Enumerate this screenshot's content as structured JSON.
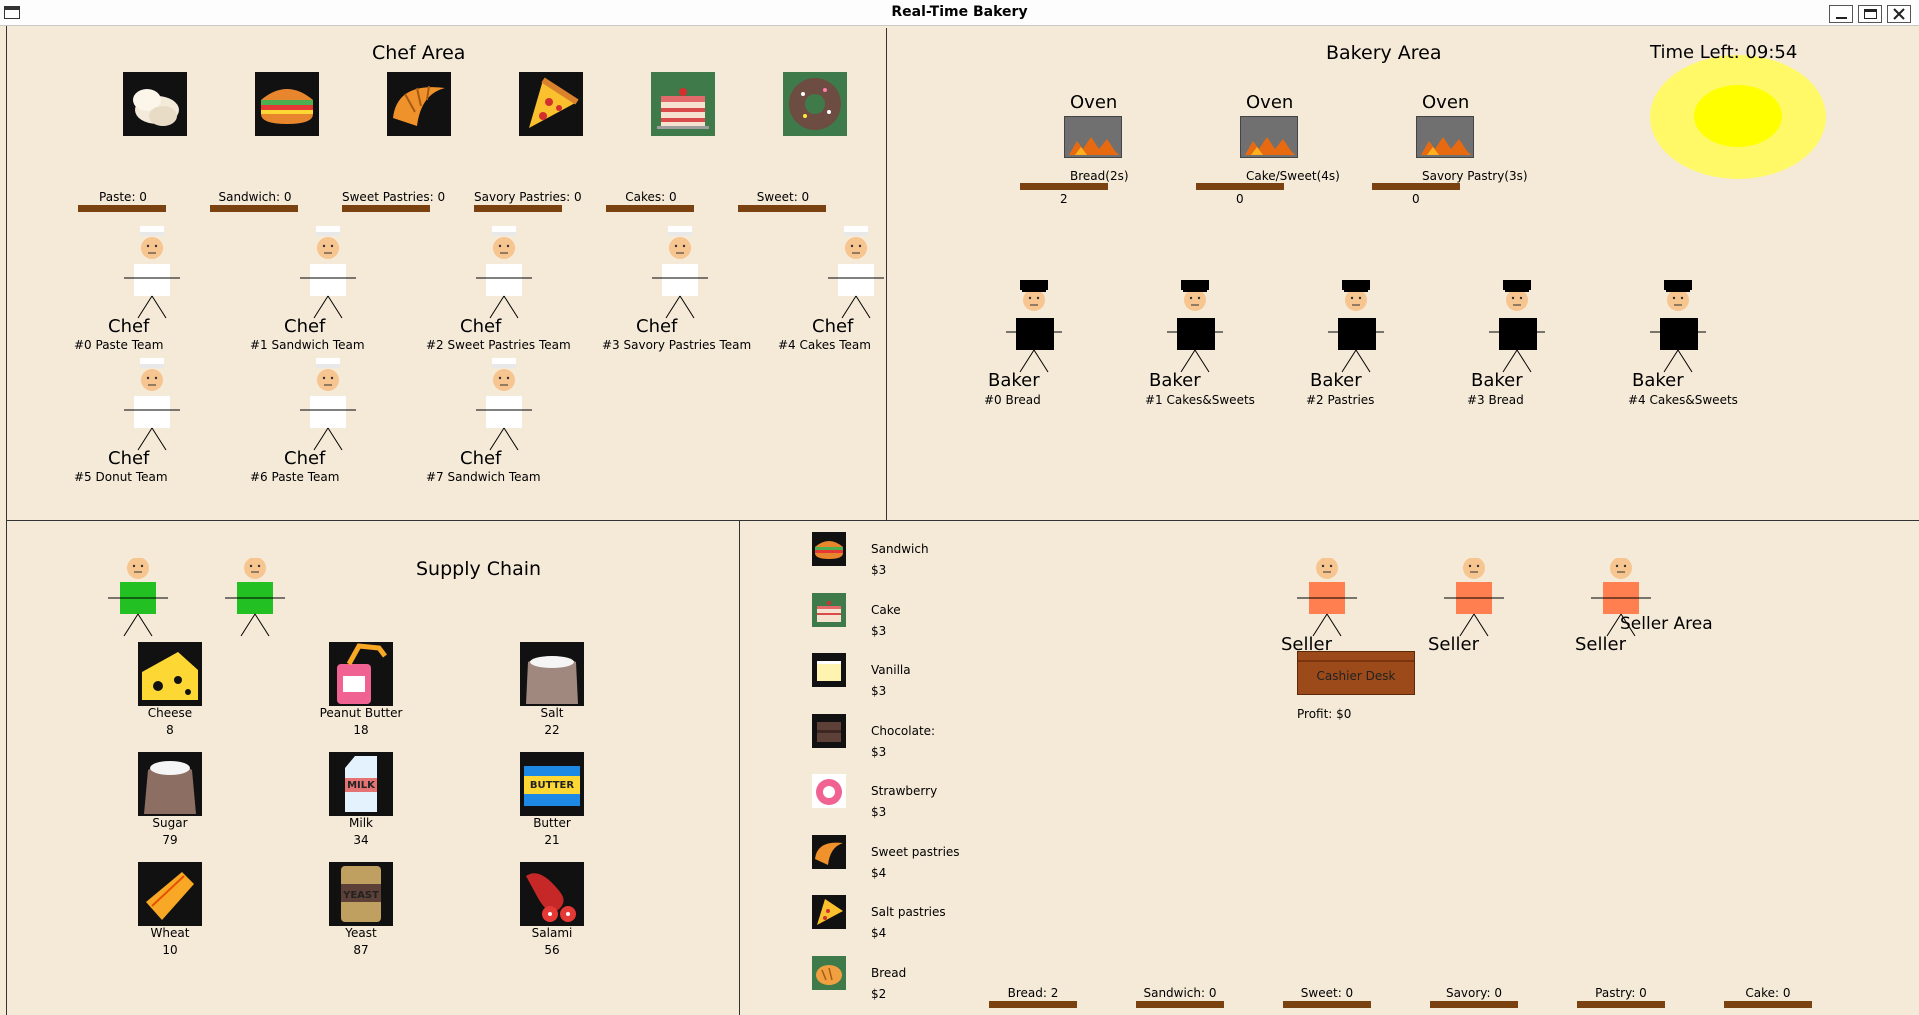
{
  "window": {
    "title": "Real-Time Bakery"
  },
  "chef_area": {
    "title": "Chef Area",
    "food_icons": [
      "bread-dough-icon",
      "sandwich-icon",
      "croissant-icon",
      "pizza-icon",
      "cake-icon",
      "donut-icon"
    ],
    "counters": [
      "Paste: 0",
      "Sandwich: 0",
      "Sweet Pastries: 0",
      "Savory Pastries: 0",
      "Cakes: 0",
      "Sweet: 0"
    ],
    "chef_label": "Chef",
    "chefs": [
      "#0 Paste Team",
      "#1 Sandwich Team",
      "#2 Sweet Pastries Team",
      "#3 Savory Pastries Team",
      "#4 Cakes Team",
      "#5 Donut Team",
      "#6 Paste Team",
      "#7 Sandwich Team"
    ]
  },
  "bakery_area": {
    "title": "Bakery Area",
    "time_left": "Time Left: 09:54",
    "sun_color": "#ffff00",
    "oven_label": "Oven",
    "ovens": [
      {
        "type": "Bread(2s)",
        "count": "2"
      },
      {
        "type": "Cake/Sweet(4s)",
        "count": "0"
      },
      {
        "type": "Savory Pastry(3s)",
        "count": "0"
      }
    ],
    "baker_label": "Baker",
    "bakers": [
      "#0 Bread",
      "#1 Cakes&Sweets",
      "#2 Pastries",
      "#3 Bread",
      "#4 Cakes&Sweets"
    ]
  },
  "supply_chain": {
    "title": "Supply Chain",
    "items": [
      {
        "name": "Cheese",
        "qty": "8",
        "icon": "cheese-icon"
      },
      {
        "name": "Peanut Butter",
        "qty": "18",
        "icon": "peanut-butter-icon"
      },
      {
        "name": "Salt",
        "qty": "22",
        "icon": "salt-sack-icon"
      },
      {
        "name": "Sugar",
        "qty": "79",
        "icon": "sugar-sack-icon"
      },
      {
        "name": "Milk",
        "qty": "34",
        "icon": "milk-carton-icon"
      },
      {
        "name": "Butter",
        "qty": "21",
        "icon": "butter-icon"
      },
      {
        "name": "Wheat",
        "qty": "10",
        "icon": "wheat-icon"
      },
      {
        "name": "Yeast",
        "qty": "87",
        "icon": "yeast-icon"
      },
      {
        "name": "Salami",
        "qty": "56",
        "icon": "salami-icon"
      }
    ],
    "milk_text": "MILK",
    "butter_text": "BUTTER",
    "yeast_text": "YEAST",
    "supplier_color": "#22c022"
  },
  "seller_area": {
    "title": "Seller Area",
    "menu": [
      {
        "name": "Sandwich",
        "price": "$3",
        "icon": "sandwich-icon"
      },
      {
        "name": "Cake",
        "price": "$3",
        "icon": "cake-icon"
      },
      {
        "name": "Vanilla",
        "price": "$3",
        "icon": "vanilla-cake-icon"
      },
      {
        "name": "Chocolate:",
        "price": "$3",
        "icon": "chocolate-cake-icon"
      },
      {
        "name": "Strawberry",
        "price": "$3",
        "icon": "strawberry-cake-icon"
      },
      {
        "name": "Sweet pastries",
        "price": "$4",
        "icon": "croissant-icon"
      },
      {
        "name": "Salt pastries",
        "price": "$4",
        "icon": "pizza-icon"
      },
      {
        "name": "Bread",
        "price": "$2",
        "icon": "bread-icon"
      }
    ],
    "seller_label": "Seller",
    "seller_color": "#ff7f50",
    "cashier_desk": "Cashier Desk",
    "profit": "Profit: $0",
    "stock": [
      "Bread: 2",
      "Sandwich: 0",
      "Sweet: 0",
      "Savory: 0",
      "Pastry: 0",
      "Cake: 0"
    ]
  }
}
